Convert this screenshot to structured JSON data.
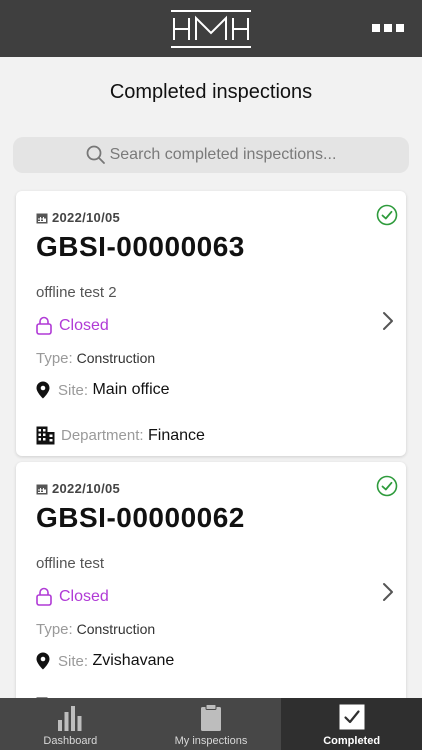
{
  "header": {
    "logo_text": "HMH",
    "menu_icon": "more-icon"
  },
  "page": {
    "title": "Completed inspections"
  },
  "search": {
    "placeholder": "Search completed inspections..."
  },
  "inspections": [
    {
      "date": "2022/10/05",
      "code": "GBSI-00000063",
      "description": "offline test 2",
      "status": "Closed",
      "type_label": "Type:",
      "type_value": "Construction",
      "site_label": "Site:",
      "site_value": "Main office",
      "department_label": "Department:",
      "department_value": "Finance"
    },
    {
      "date": "2022/10/05",
      "code": "GBSI-00000062",
      "description": "offline test",
      "status": "Closed",
      "type_label": "Type:",
      "type_value": "Construction",
      "site_label": "Site:",
      "site_value": "Zvishavane"
    }
  ],
  "tabs": [
    {
      "label": "Dashboard",
      "icon": "bar-chart-icon"
    },
    {
      "label": "My inspections",
      "icon": "clipboard-icon"
    },
    {
      "label": "Completed",
      "icon": "checkbox-icon",
      "active": true
    }
  ],
  "colors": {
    "header_bg": "#3f3f3f",
    "status_closed": "#b03ad6",
    "check_green": "#2e9b3c",
    "tabbar_bg": "#474747"
  }
}
